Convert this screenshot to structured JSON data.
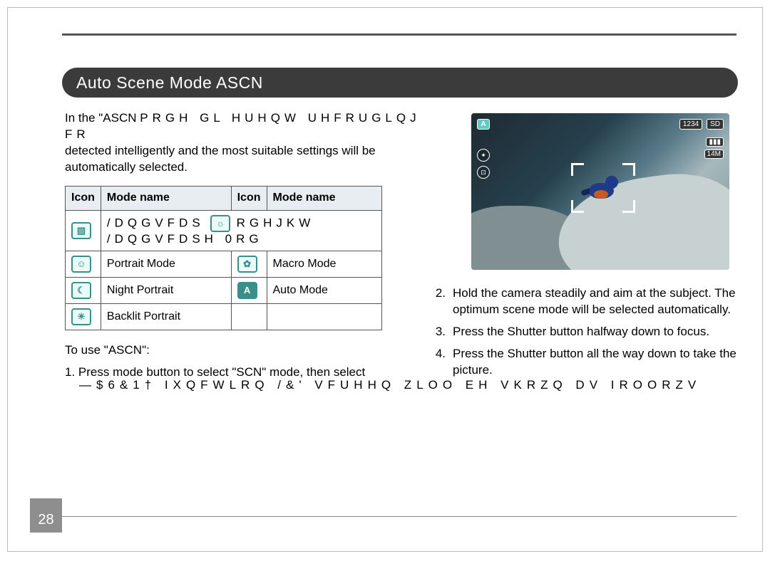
{
  "page_number": "28",
  "section_title": "Auto Scene Mode ASCN",
  "intro": {
    "line1a": "In the \"ASCN",
    "line1b": "PRGH  GL HUHQW UHFRUGLQJ FR",
    "line2": "detected intelligently and the most suitable settings will be",
    "line3": "automatically selected."
  },
  "table": {
    "headers": {
      "icon": "Icon",
      "mode": "Mode name"
    },
    "rows": [
      {
        "icon1": "▧",
        "name1_g": "/DQGVFDS",
        "icon2": "☼",
        "name2_g": "RGHJKW /DQGVFDSH 0RG"
      },
      {
        "icon1": "☺",
        "name1": "Portrait Mode",
        "icon2": "✿",
        "name2": "Macro Mode"
      },
      {
        "icon1": "☾",
        "name1": "Night Portrait",
        "icon2": "A",
        "name2": "Auto Mode"
      },
      {
        "icon1": "☀",
        "name1": "Backlit Portrait",
        "icon2": "",
        "name2": ""
      }
    ]
  },
  "to_use_label": "To use \"ASCN\":",
  "step1": "1.   Press mode button to select \"SCN\" mode, then select",
  "garbled_full": "—$6&1†  IXQFWLRQ  /&' VFUHHQ ZLOO EH VKRZQ DV IROORZV",
  "right_steps": {
    "s2n": "2.",
    "s2": "Hold the camera steadily and aim at the subject. The optimum scene mode will be selected automatically.",
    "s3n": "3.",
    "s3": "Press the Shutter button halfway down to focus.",
    "s4n": "4.",
    "s4": "Press the Shutter button all the way down to take the picture."
  },
  "hud": {
    "a": "A",
    "counter": "1234",
    "sd": "SD",
    "batt": "▮▮▮",
    "mp": "14M"
  }
}
